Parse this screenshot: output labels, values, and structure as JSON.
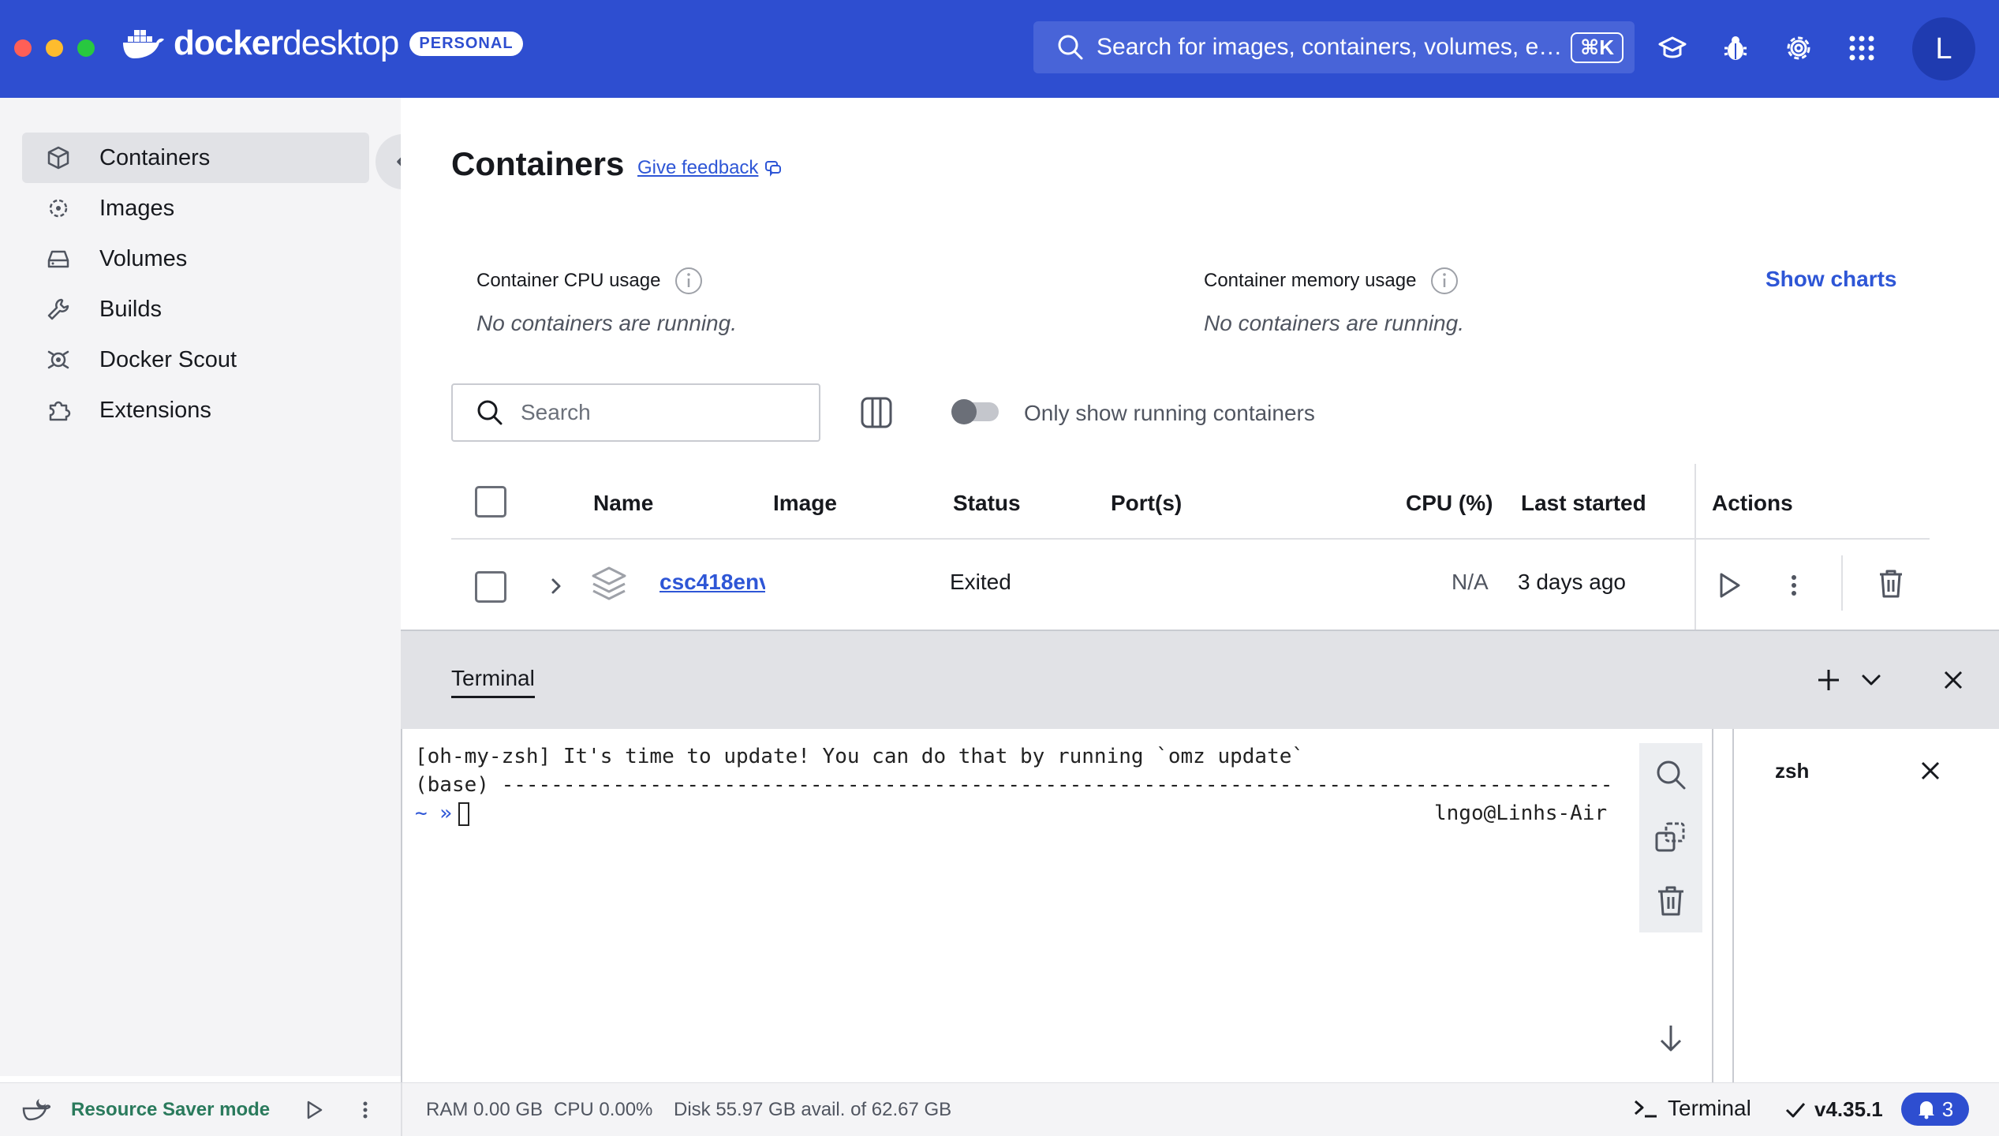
{
  "app": {
    "logo_text_bold": "docker",
    "logo_text_light": "desktop",
    "plan_badge": "PERSONAL",
    "search_placeholder": "Search for images, containers, volumes, e…",
    "search_shortcut": "⌘K",
    "avatar_initial": "L"
  },
  "sidebar": {
    "items": [
      {
        "label": "Containers",
        "icon": "cube-icon",
        "active": true
      },
      {
        "label": "Images",
        "icon": "image-layers-icon"
      },
      {
        "label": "Volumes",
        "icon": "drive-icon"
      },
      {
        "label": "Builds",
        "icon": "wrench-icon"
      },
      {
        "label": "Docker Scout",
        "icon": "scout-icon"
      },
      {
        "label": "Extensions",
        "icon": "puzzle-icon"
      }
    ]
  },
  "main": {
    "title": "Containers",
    "feedback_link": "Give feedback",
    "cpu_label": "Container CPU usage",
    "cpu_value": "No containers are running.",
    "mem_label": "Container memory usage",
    "mem_value": "No containers are running.",
    "show_charts": "Show charts",
    "search_placeholder": "Search",
    "running_toggle_label": "Only show running containers",
    "table": {
      "headers": [
        "Name",
        "Image",
        "Status",
        "Port(s)",
        "CPU (%)",
        "Last started",
        "Actions"
      ],
      "rows": [
        {
          "name": "csc418env",
          "image": "",
          "status": "Exited",
          "ports": "",
          "cpu": "N/A",
          "last_started": "3 days ago"
        }
      ]
    }
  },
  "terminal": {
    "tab_label": "Terminal",
    "line1": "[oh-my-zsh] It's time to update! You can do that by running `omz update`",
    "line2": "(base) ------------------------------------------------------------------------------------------",
    "prompt": "~ »",
    "host": "lngo@Linhs-Air",
    "session_name": "zsh"
  },
  "footer": {
    "resource_saver": "Resource Saver mode",
    "ram": "RAM 0.00 GB",
    "cpu": "CPU 0.00%",
    "disk": "Disk 55.97 GB avail. of 62.67 GB",
    "terminal_button": "Terminal",
    "version": "v4.35.1",
    "notifications": "3"
  },
  "colors": {
    "brand": "#2e4ed0",
    "link": "#2e56d6",
    "sidebar_bg": "#f4f4f6"
  }
}
